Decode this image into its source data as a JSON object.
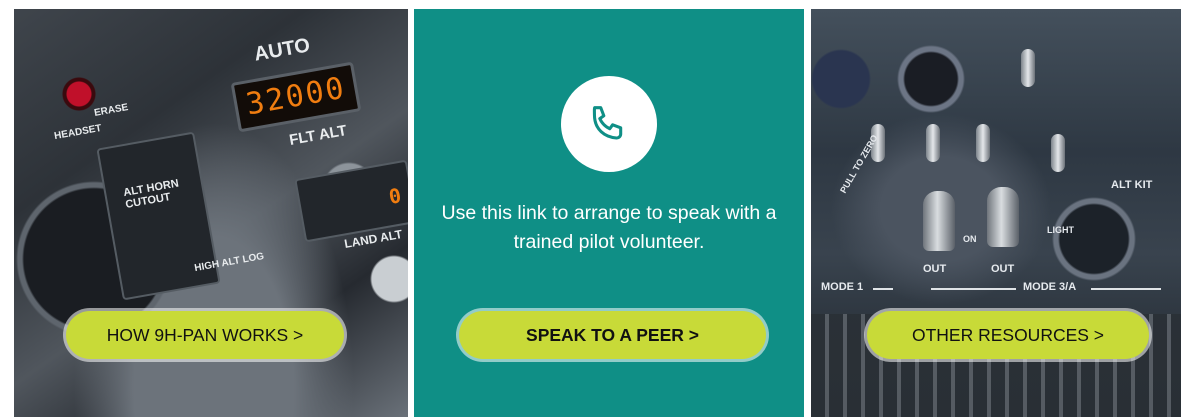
{
  "tiles": [
    {
      "photo": {
        "altitude_readout": "32000",
        "labels": [
          "AUTO",
          "FLT ALT",
          "HEADSET",
          "ERASE",
          "ALT HORN CUTOUT",
          "HIGH ALT LOG",
          "LAND ALT",
          "0"
        ]
      },
      "button_label": "HOW 9H-PAN WORKS >"
    },
    {
      "icon": "phone-icon",
      "text": "Use this link to arrange to speak with a trained pilot volunteer.",
      "button_label": "SPEAK TO A PEER >"
    },
    {
      "photo": {
        "labels": [
          "OUT",
          "OUT",
          "MODE 1",
          "MODE 3/A",
          "ALT KIT",
          "PULL TO ZERO",
          "ON",
          "LIGHT"
        ]
      },
      "button_label": "OTHER RESOURCES >"
    }
  ],
  "colors": {
    "teal": "#0f8f86",
    "button": "#c8da38",
    "text_on_teal": "#ffffff"
  }
}
